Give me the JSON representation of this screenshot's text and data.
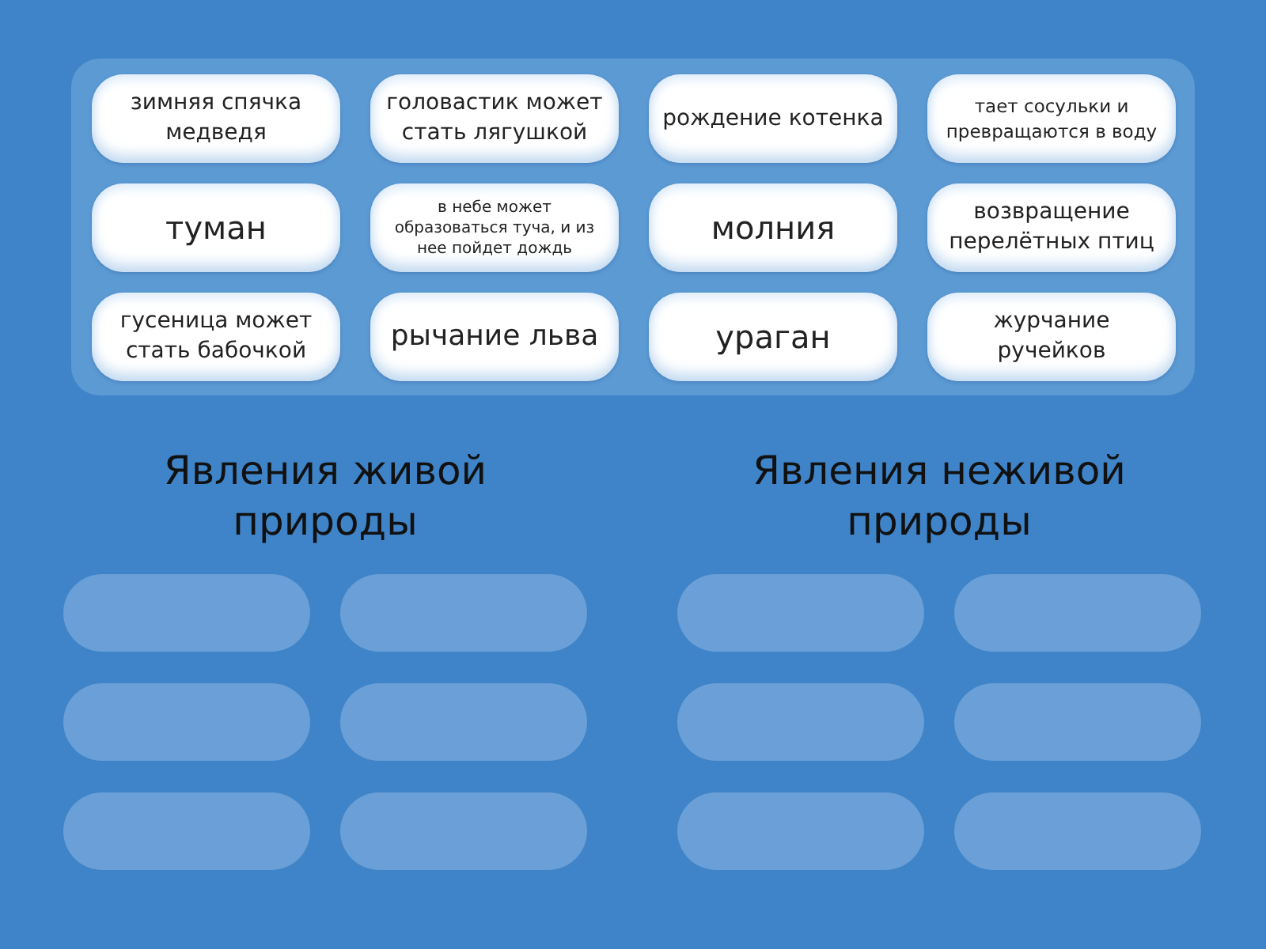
{
  "cards": [
    {
      "text": "зимняя спячка медведя"
    },
    {
      "text": "головастик может стать лягушкой"
    },
    {
      "text": "рождение котенка"
    },
    {
      "text": "тает сосульки и превращаются в воду"
    },
    {
      "text": "туман"
    },
    {
      "text": "в небе может образоваться туча, и из нее пойдет дождь"
    },
    {
      "text": "молния"
    },
    {
      "text": "возвращение перелётных птиц"
    },
    {
      "text": "гусеница может стать бабочкой"
    },
    {
      "text": "рычание льва"
    },
    {
      "text": "ураган"
    },
    {
      "text": "журчание ручейков"
    }
  ],
  "categories": [
    {
      "title": "Явления живой природы",
      "slots": [
        {
          "kind": "empty"
        },
        {
          "kind": "empty"
        },
        {
          "kind": "empty"
        },
        {
          "kind": "empty"
        },
        {
          "kind": "empty"
        },
        {
          "kind": "empty"
        }
      ]
    },
    {
      "title": "Явления неживой природы",
      "slots": [
        {
          "kind": "empty"
        },
        {
          "kind": "empty"
        },
        {
          "kind": "empty"
        },
        {
          "kind": "empty"
        },
        {
          "kind": "empty"
        },
        {
          "kind": "empty"
        }
      ]
    }
  ]
}
